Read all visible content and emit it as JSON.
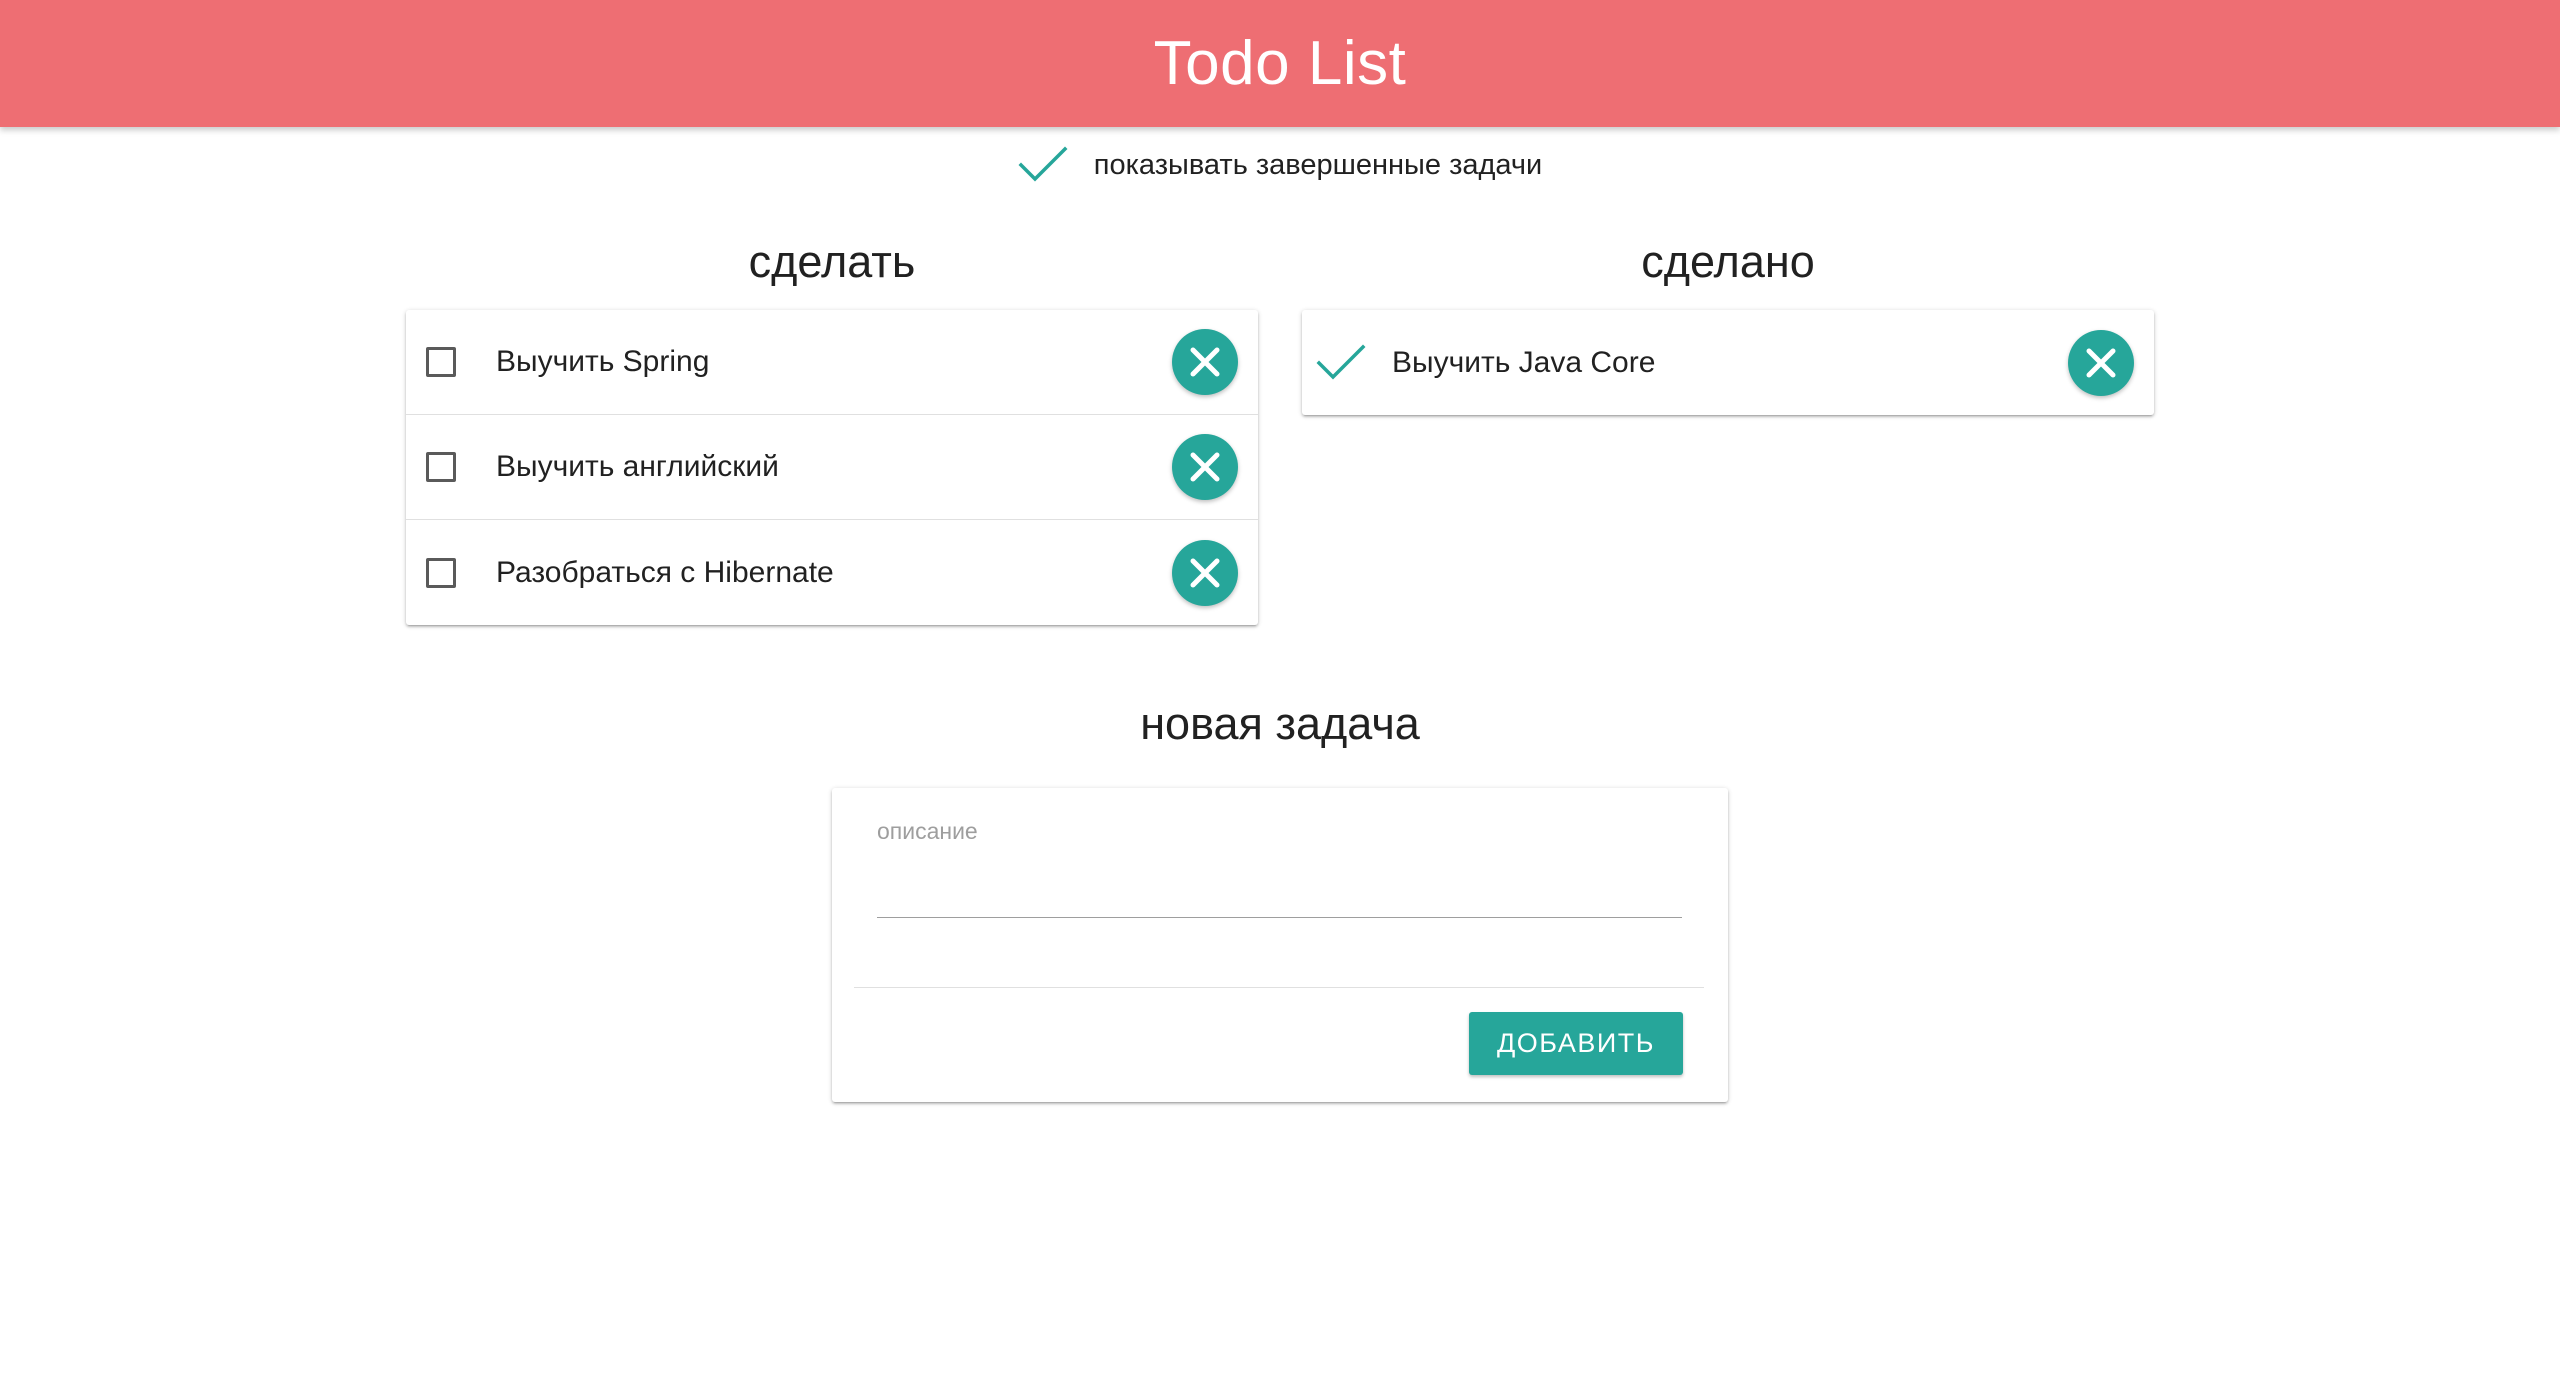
{
  "header": {
    "title": "Todo List"
  },
  "filter": {
    "show_completed_label": "показывать завершенные задачи",
    "show_completed": true
  },
  "todo": {
    "heading": "сделать",
    "items": [
      {
        "text": "Выучить Spring",
        "done": false
      },
      {
        "text": "Выучить английский",
        "done": false
      },
      {
        "text": "Разобраться с Hibernate",
        "done": false
      }
    ]
  },
  "done": {
    "heading": "сделано",
    "items": [
      {
        "text": "Выучить Java Core",
        "done": true
      }
    ]
  },
  "new_task": {
    "heading": "новая задача",
    "description_label": "описание",
    "description_value": "",
    "add_button": "ДОБАВИТЬ"
  },
  "icons": {
    "check": "check-icon",
    "delete": "close-circle-icon"
  },
  "colors": {
    "header": "#ee6e73",
    "accent": "#26a69a"
  }
}
